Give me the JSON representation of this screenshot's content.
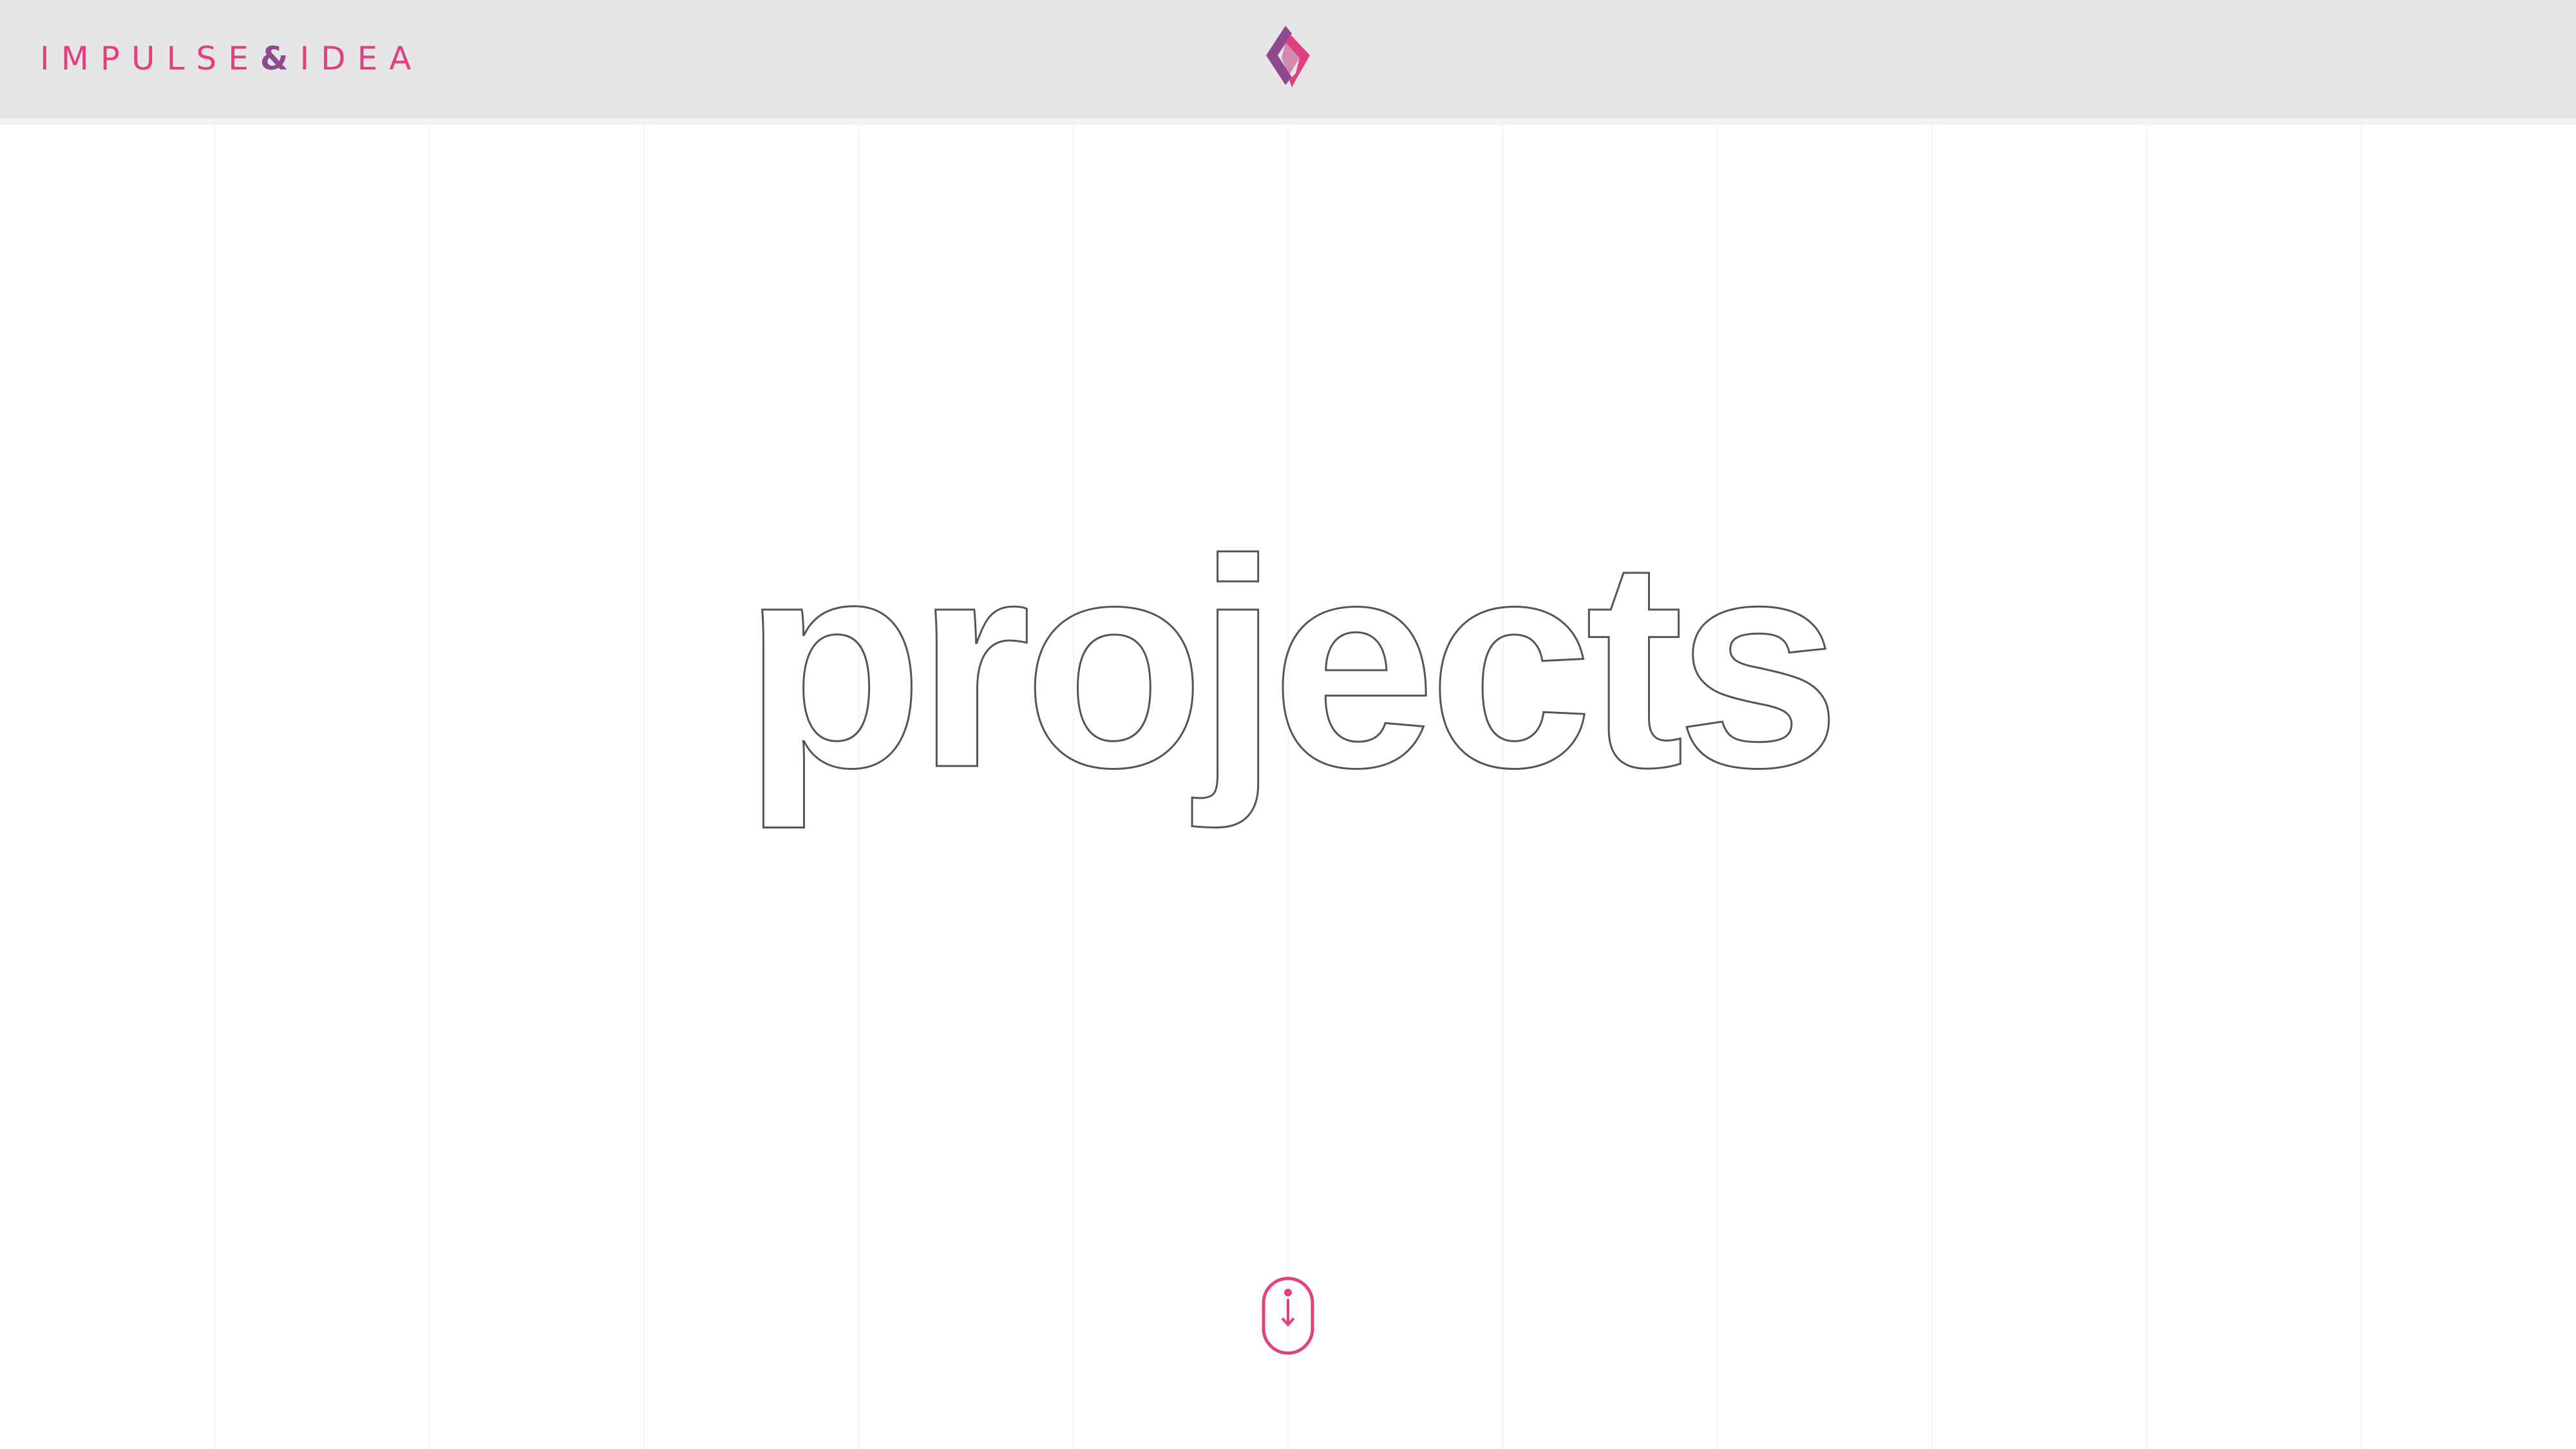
{
  "header": {
    "brand": {
      "part1": "IMPULSE",
      "amp": "&",
      "part2": "IDEA"
    },
    "logo_icon": "diamond-chevron-logo-icon"
  },
  "hero": {
    "title": "projects"
  },
  "scroll": {
    "icon": "mouse-scroll-icon"
  },
  "colors": {
    "header_bg": "#e6e6e6",
    "brand_pink": "#e0407f",
    "brand_purple": "#8e4a8c",
    "title_outline": "#555555",
    "grid_line": "#f4f4f4"
  }
}
